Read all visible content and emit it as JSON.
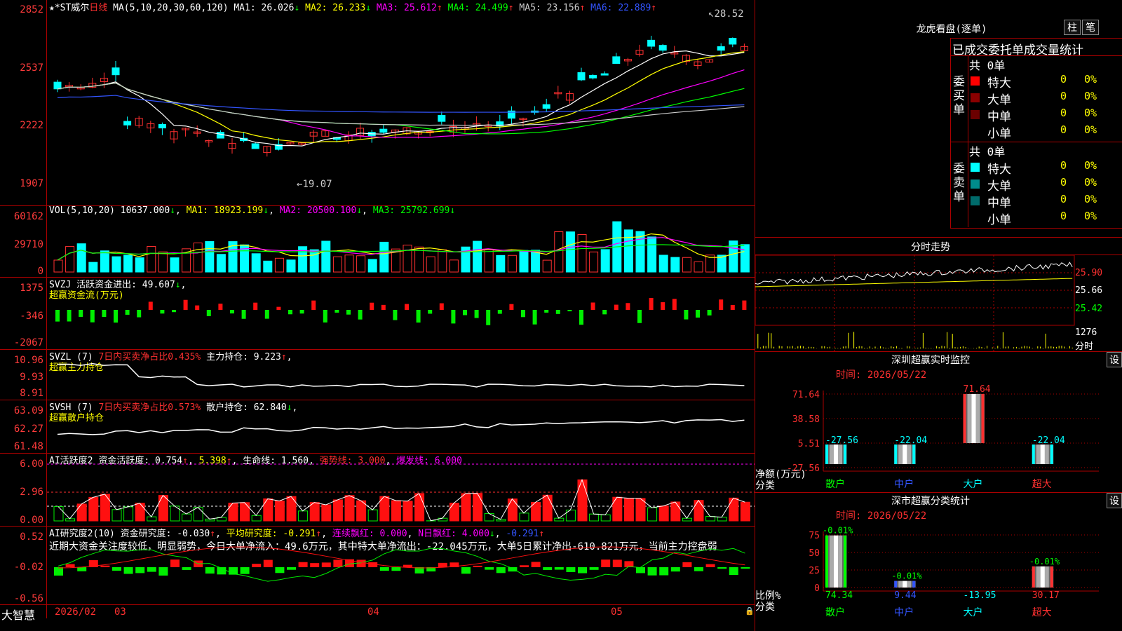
{
  "stock": {
    "name": "★*ST威尔",
    "period": "日线"
  },
  "ma_header": {
    "label": "MA(5,10,20,30,60,120)",
    "items": [
      {
        "name": "MA1:",
        "value": "26.026",
        "arrow": "↓",
        "color": "#ffffff"
      },
      {
        "name": "MA2:",
        "value": "26.233",
        "arrow": "↓",
        "color": "#ffff00"
      },
      {
        "name": "MA3:",
        "value": "25.612",
        "arrow": "↑",
        "color": "#ff00ff"
      },
      {
        "name": "MA4:",
        "value": "24.499",
        "arrow": "↑",
        "color": "#00ff00"
      },
      {
        "name": "MA5:",
        "value": "23.156",
        "arrow": "↑",
        "color": "#cccccc"
      },
      {
        "name": "MA6:",
        "value": "22.889",
        "arrow": "↑",
        "color": "#3355ff"
      }
    ]
  },
  "price_axis": [
    "2852",
    "2537",
    "2222",
    "1907"
  ],
  "price_annotations": {
    "high": "28.52",
    "low": "19.07"
  },
  "vol_header": {
    "label": "VOL(5,10,20)",
    "value": "10637.000",
    "ma1": "MA1: 18923.199",
    "ma2": "MA2: 20500.100",
    "ma3": "MA3: 25792.699"
  },
  "vol_axis": [
    "60162",
    "29710",
    "0"
  ],
  "svzj": {
    "line1_label": "SVZJ  活跃资金进出:",
    "line1_value": "49.607",
    "line2": "超赢资金流(万元)",
    "axis": [
      "1375",
      "-346",
      "-2067"
    ]
  },
  "svzl": {
    "line1_label": "SVZL (7)",
    "line1_mid": "7日内买卖净占比0.435%",
    "line1_hold": "主力持仓: 9.223",
    "line2": "超赢主力持仓",
    "axis": [
      "10.96",
      "9.93",
      "8.91"
    ]
  },
  "svsh": {
    "line1_label": "SVSH (7)",
    "line1_mid": "7日内买卖净占比0.573%",
    "line1_hold": "散户持仓: 62.840",
    "line2": "超赢散户持仓",
    "axis": [
      "63.09",
      "62.27",
      "61.48"
    ]
  },
  "ai_active": {
    "label": "AI活跃度2",
    "degree": "资金活跃度: 0.754",
    "v2": "5.398",
    "life": "生命线: 1.560",
    "strong": "强势线: 3.000",
    "burst": "爆发线: 6.000",
    "axis": [
      "6.00",
      "2.96",
      "0.00"
    ]
  },
  "ai_research": {
    "label": "AI研究度2(10)",
    "degree": "资金研究度: -0.030",
    "avg": "平均研究度: -0.291",
    "cont": "连续飘红: 0.000",
    "nday": "N日飘红: 4.000",
    "v5": "-0.291",
    "note": "近期大资金关注度较低，明显弱势，今日大单净流入：49.6万元，其中特大单净流出：-22.045万元，大单5日累计净出-610.821万元，当前主力控盘弱",
    "axis": [
      "0.52",
      "-0.02",
      "-0.56"
    ]
  },
  "date_axis": {
    "start": "2026/02",
    "m03": "03",
    "m04": "04",
    "m05": "05"
  },
  "footer_logo": "大智慧",
  "right": {
    "longhu_title": "龙虎看盘(逐单)",
    "btn_bar": "柱",
    "btn_pen": "笔",
    "tabs": "已成交委托单成交量统计",
    "buy_side": {
      "label": "委买单",
      "total": "共 0单",
      "rows": [
        {
          "name": "特大",
          "count": "0",
          "pct": "0%",
          "color": "#ff0000"
        },
        {
          "name": "大单",
          "count": "0",
          "pct": "0%",
          "color": "#8b0000"
        },
        {
          "name": "中单",
          "count": "0",
          "pct": "0%",
          "color": "#6b0000"
        },
        {
          "name": "小单",
          "count": "0",
          "pct": "0%",
          "color": "#000000"
        }
      ]
    },
    "sell_side": {
      "label": "委卖单",
      "total": "共 0单",
      "rows": [
        {
          "name": "特大",
          "count": "0",
          "pct": "0%",
          "color": "#00ffff"
        },
        {
          "name": "大单",
          "count": "0",
          "pct": "0%",
          "color": "#008b8b"
        },
        {
          "name": "中单",
          "count": "0",
          "pct": "0%",
          "color": "#006b6b"
        },
        {
          "name": "小单",
          "count": "0",
          "pct": "0%",
          "color": "#000000"
        }
      ]
    },
    "intraday_title": "分时走势",
    "intraday_axis": [
      "25.90",
      "25.66",
      "25.42"
    ],
    "intraday_vol": "1276",
    "intraday_vol_label": "分时",
    "sz_monitor": {
      "title": "深圳超赢实时监控",
      "btn": "设",
      "time": "时间: 2026/05/22",
      "axis": [
        "71.64",
        "38.58",
        "5.51",
        "-27.56"
      ],
      "ylabel1": "净额(万元)",
      "ylabel2": "分类"
    },
    "sz_class": {
      "title": "深市超赢分类统计",
      "btn": "设",
      "time": "时间: 2026/05/22",
      "axis": [
        "75",
        "50",
        "25",
        "0"
      ],
      "ylabel1": "比例%",
      "ylabel2": "分类"
    }
  },
  "chart_data": [
    {
      "type": "bar",
      "title": "深圳超赢实时监控",
      "categories": [
        "散户",
        "中户",
        "大户",
        "超大"
      ],
      "values": [
        -27.56,
        -22.04,
        71.64,
        -22.04
      ],
      "ylabel": "净额(万元)",
      "ylim": [
        -27.56,
        71.64
      ]
    },
    {
      "type": "bar",
      "title": "深市超赢分类统计",
      "categories": [
        "散户",
        "中户",
        "大户",
        "超大"
      ],
      "values": [
        74.34,
        9.44,
        -13.95,
        30.17
      ],
      "annotations": [
        "-0.01%",
        "-0.01%",
        "",
        "-0.01%"
      ],
      "ylabel": "比例%",
      "ylim": [
        0,
        75
      ]
    }
  ]
}
